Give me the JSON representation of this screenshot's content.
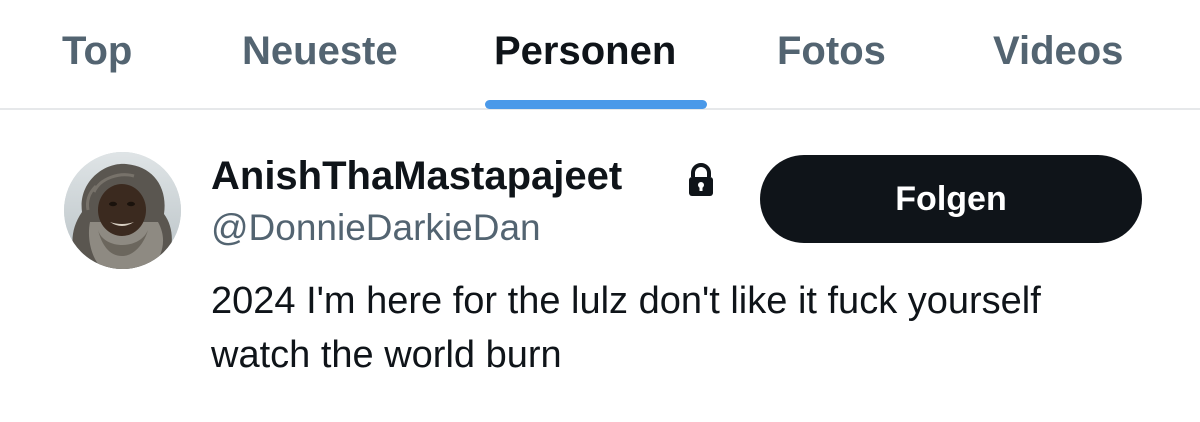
{
  "tabs": [
    {
      "label": "Top",
      "active": false
    },
    {
      "label": "Neueste",
      "active": false
    },
    {
      "label": "Personen",
      "active": true
    },
    {
      "label": "Fotos",
      "active": false
    },
    {
      "label": "Videos",
      "active": false
    }
  ],
  "user": {
    "display_name": "AnishThaMastapajeet",
    "handle": "@DonnieDarkieDan",
    "protected_icon": "lock-icon",
    "avatar_icon": "avatar-photo",
    "bio": "2024 I'm here for the lulz don't like it fuck yourself watch the world burn",
    "follow_label": "Folgen"
  },
  "colors": {
    "accent": "#4a99e9",
    "text_primary": "#0f1419",
    "text_secondary": "#536471",
    "button_bg": "#0f1419",
    "button_text": "#ffffff",
    "divider": "#e6e8ea"
  }
}
